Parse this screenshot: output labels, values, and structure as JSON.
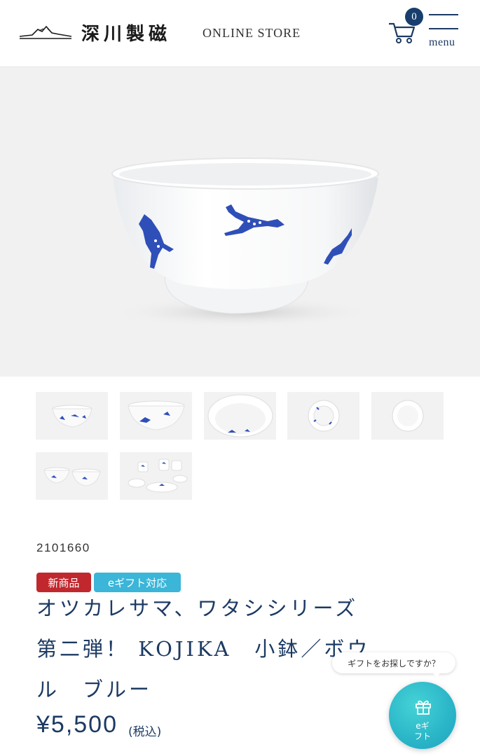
{
  "header": {
    "logo_text": "深川製磁",
    "store_label": "ONLINE STORE",
    "cart_count": "0",
    "menu_label": "menu"
  },
  "hero": {
    "description_icon": "bowl-with-deer-pattern"
  },
  "thumbnails": [
    {
      "icon": "bowl-side-view"
    },
    {
      "icon": "bowl-angled-view"
    },
    {
      "icon": "bowl-top-view"
    },
    {
      "icon": "bowl-bottom-view"
    },
    {
      "icon": "bowl-inside-view"
    },
    {
      "icon": "bowl-pair"
    },
    {
      "icon": "tableware-set"
    }
  ],
  "product": {
    "code": "2101660",
    "badges": {
      "new": "新商品",
      "gift": "eギフト対応"
    },
    "title_line1": "オツカレサマ、ワタシシリーズ",
    "title_line2": "第二弾！ KOJIKA　小鉢／ボウ",
    "title_line3": "ル　ブルー",
    "price": "¥5,500",
    "tax_label": "(税込)"
  },
  "gift_helper": {
    "bubble_text": "ギフトをお探しですか？",
    "fab_label": "eギ\nフト"
  },
  "colors": {
    "navy": "#1c3a63",
    "badge_red": "#c0282e",
    "badge_blue": "#3bb5d8",
    "fab_teal": "#2ab5c8"
  }
}
